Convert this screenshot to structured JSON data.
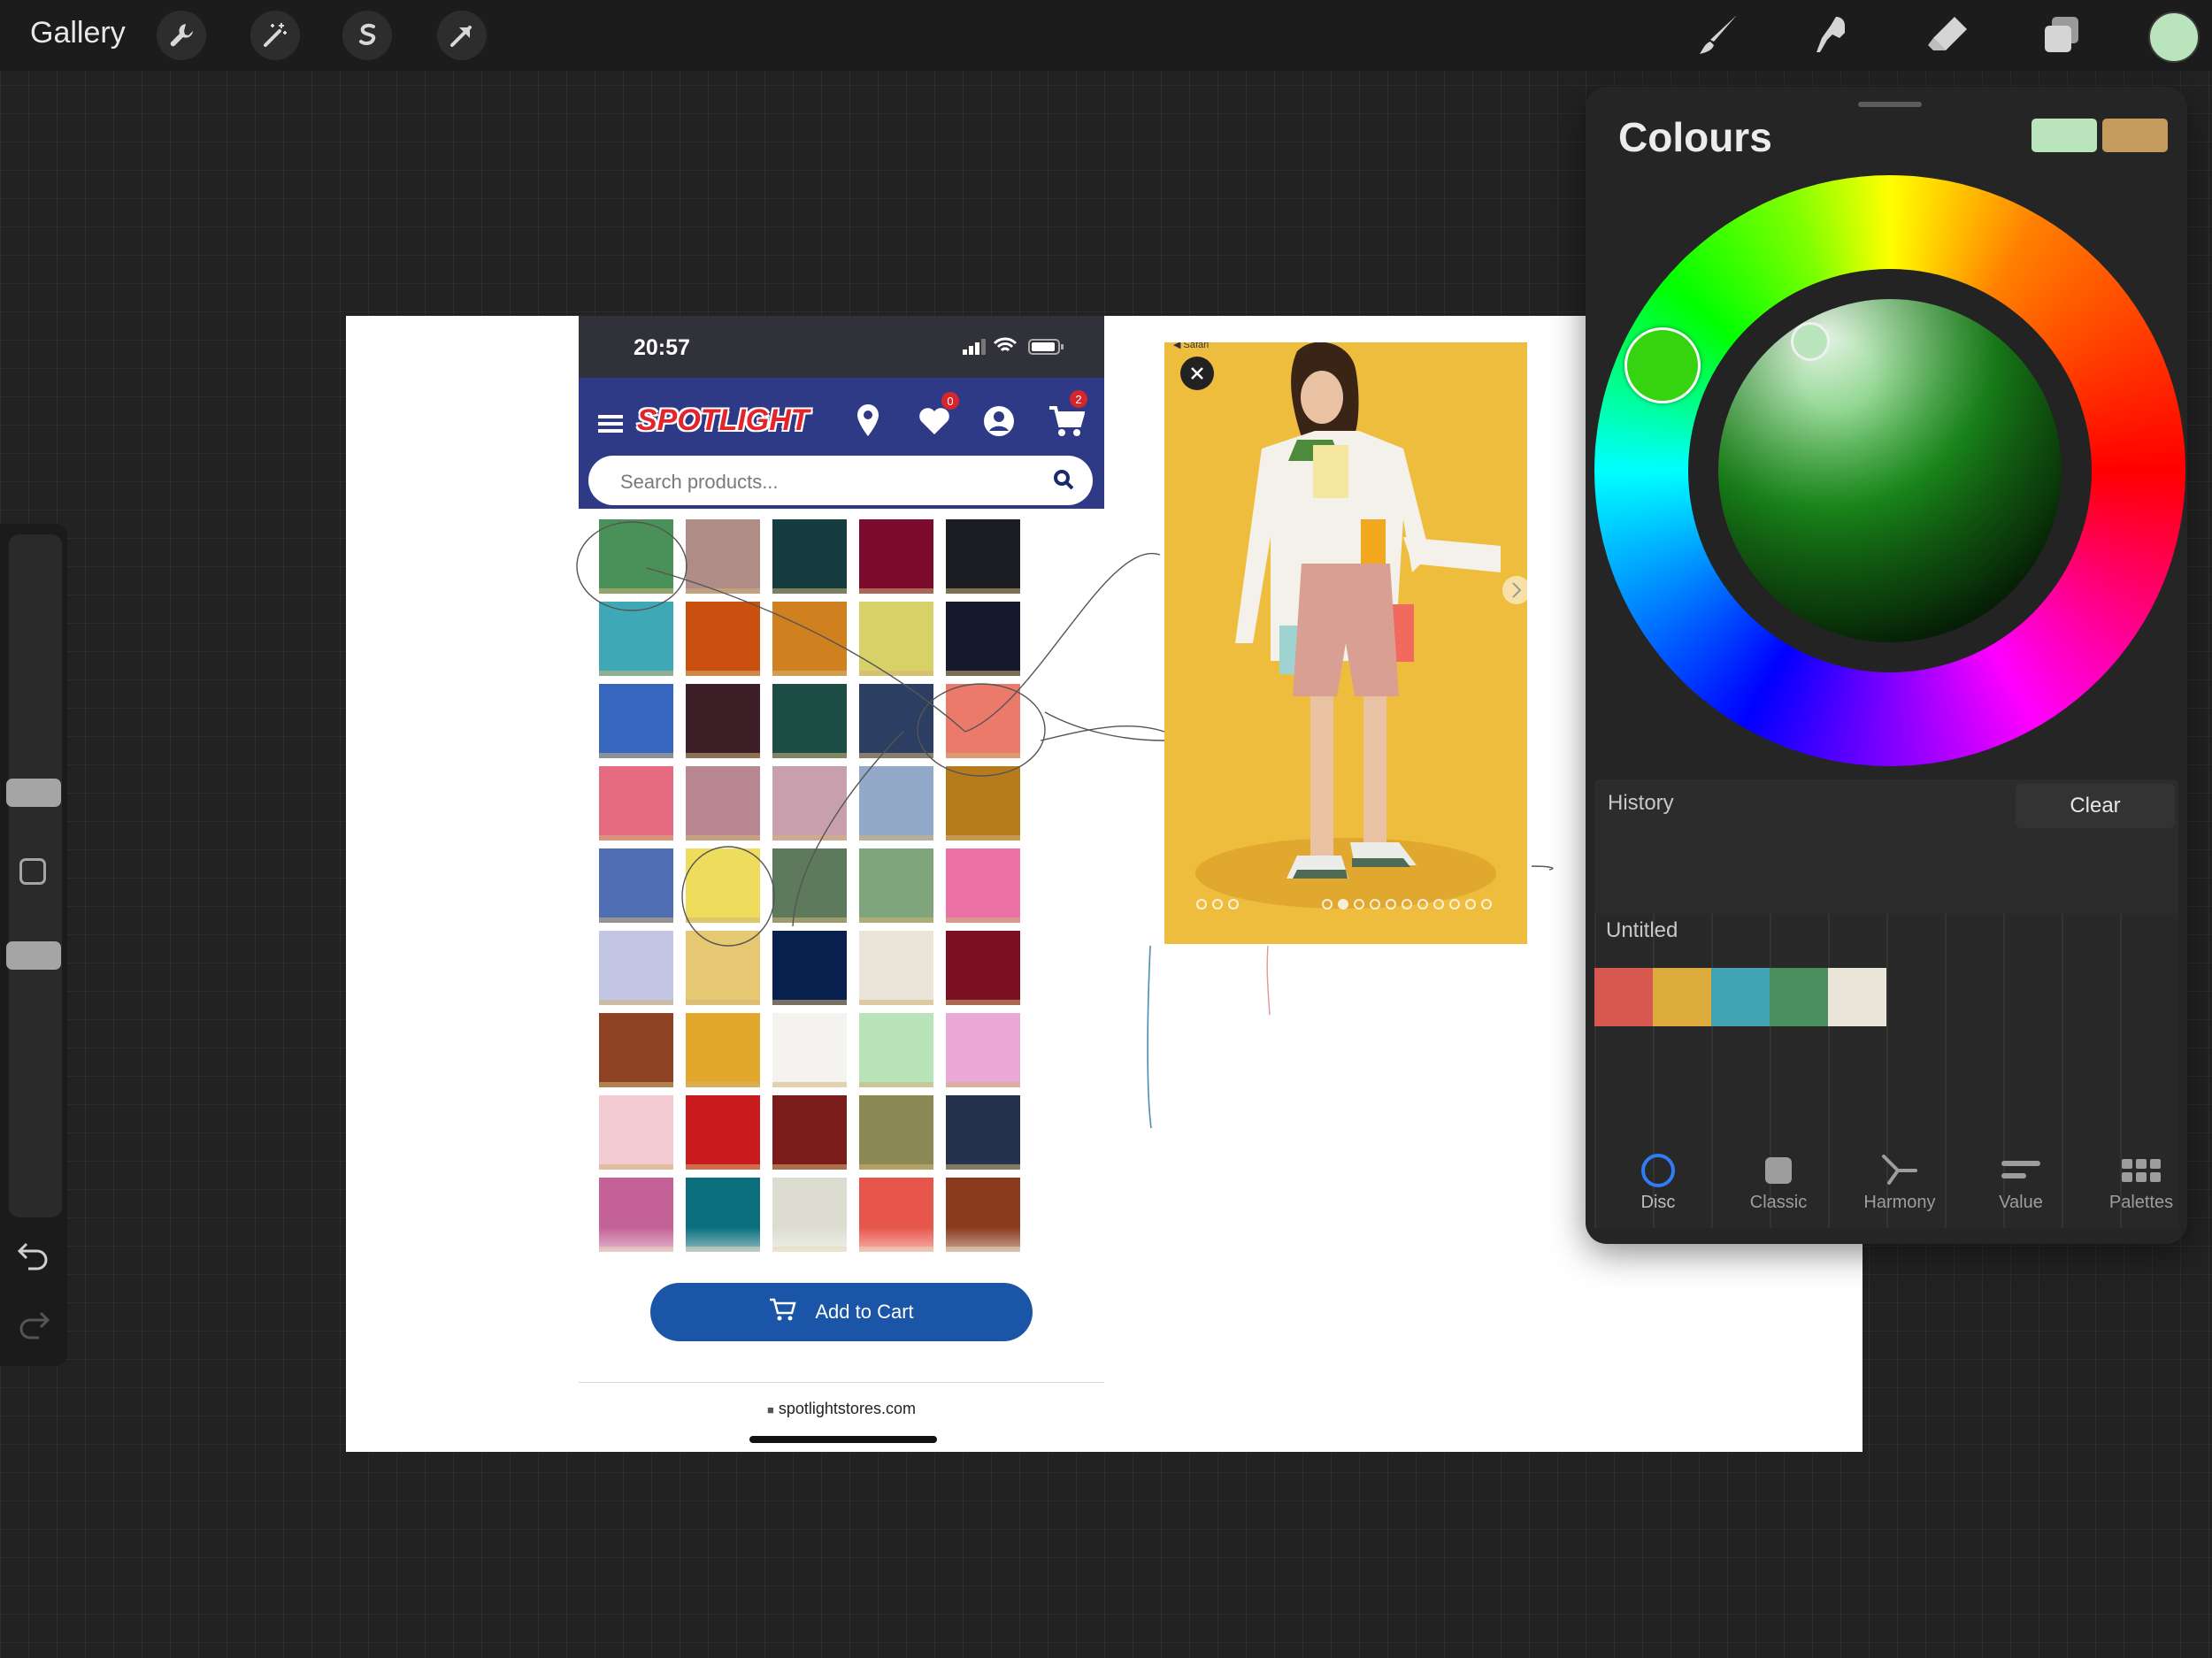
{
  "toolbar": {
    "gallery_label": "Gallery",
    "left_tools": [
      "wrench-icon",
      "magic-wand-icon",
      "selection-icon",
      "transform-arrow-icon"
    ],
    "right_tools": [
      "brush-icon",
      "smudge-icon",
      "eraser-icon",
      "layers-icon"
    ],
    "current_color": "#b9e4bc"
  },
  "phone": {
    "time": "20:57",
    "brand": "SPOTLIGHT",
    "wishlist_count": "0",
    "cart_count": "2",
    "search_placeholder": "Search products...",
    "swatches": [
      "#4a9159",
      "#b08c86",
      "#153c3e",
      "#7d0b2e",
      "#1c1d22",
      "#3fa8b6",
      "#c9500f",
      "#d0801e",
      "#d7d168",
      "#141a2c",
      "#3666be",
      "#3c1e26",
      "#1d4e46",
      "#2c3f62",
      "#ec7a6a",
      "#e56b81",
      "#b88791",
      "#c8a0ad",
      "#93a9c9",
      "#b57b1c",
      "#4f6eb4",
      "#eedd5c",
      "#5d7b5c",
      "#80a47c",
      "#ec72a6",
      "#c3c5e4",
      "#e6c873",
      "#08204e",
      "#ebe4d8",
      "#7d0f23",
      "#8e4123",
      "#e1a82d",
      "#f4f3f0",
      "#b9e3b9",
      "#e9a8d6",
      "#f3cbd2",
      "#c91a1e",
      "#7b1c1a",
      "#8d8954",
      "#24324d",
      "#c46197",
      "#0a6e7d",
      "#dcddd0",
      "#e7564b",
      "#8a3a1d"
    ],
    "add_to_cart": "Add to Cart",
    "url": "spotlightstores.com"
  },
  "photo": {
    "safari_back": "◀ Safari"
  },
  "colours_panel": {
    "title": "Colours",
    "primary": "#b9e4bc",
    "secondary": "#c49a5d",
    "history_label": "History",
    "clear_label": "Clear",
    "palette_name": "Untitled",
    "palette": [
      "#d6584e",
      "#dcab3c",
      "#42a3b2",
      "#4a8e5e",
      "#ebe4d8"
    ],
    "tabs": [
      {
        "label": "Disc",
        "icon": "disc-icon"
      },
      {
        "label": "Classic",
        "icon": "classic-square-icon"
      },
      {
        "label": "Harmony",
        "icon": "harmony-icon"
      },
      {
        "label": "Value",
        "icon": "value-sliders-icon"
      },
      {
        "label": "Palettes",
        "icon": "palettes-grid-icon"
      }
    ],
    "active_tab": "Disc"
  }
}
